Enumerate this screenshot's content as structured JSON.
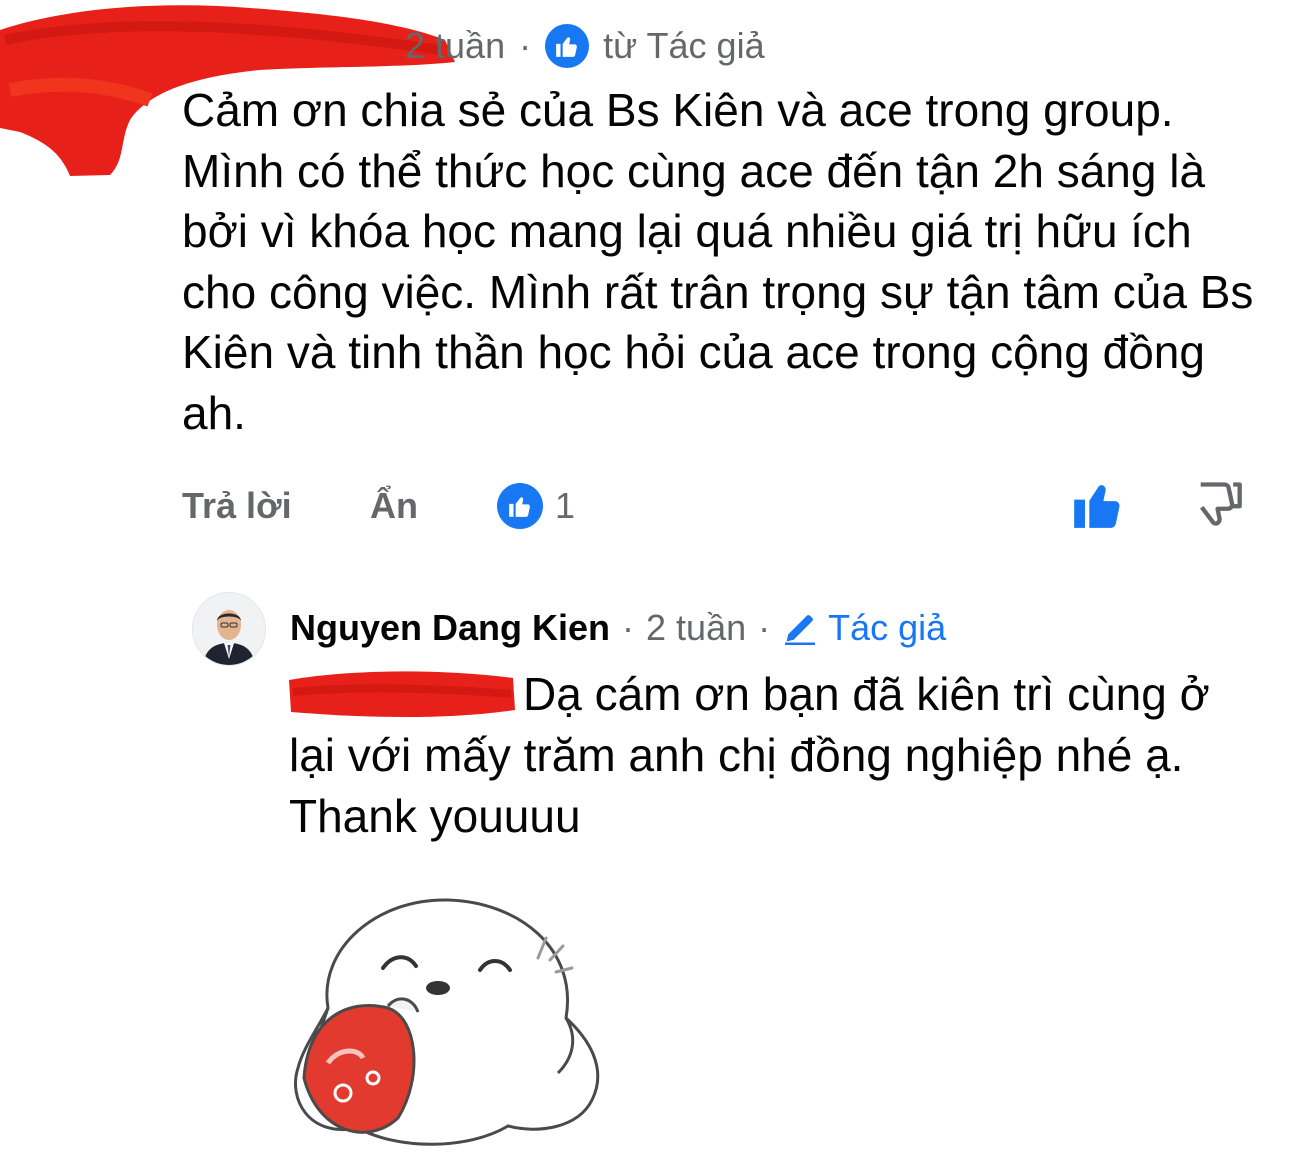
{
  "top_comment": {
    "author_name_partial": "",
    "time": "2 tuần",
    "separator": "·",
    "like_badge_icon": "thumbs-up-icon",
    "by_author_label": "từ Tác giả",
    "text": "Cảm ơn chia sẻ của Bs Kiên và ace trong group. Mình có thể thức  học cùng ace đến tận 2h sáng là bởi vì khóa học mang lại quá nhiều giá trị hữu ích cho công việc. Mình rất trân trọng sự tận tâm của Bs Kiên và tinh thần học hỏi của ace trong cộng đồng ah.",
    "actions": {
      "reply_label": "Trả lời",
      "hide_label": "Ẩn",
      "reaction_count": "1"
    }
  },
  "reply": {
    "author_name": "Nguyen Dang Kien",
    "separator": "·",
    "time": "2 tuần",
    "author_tag": "Tác giả",
    "text": "Dạ cám ơn bạn đã kiên trì cùng ở lại với mấy trăm anh chị đồng nghiệp nhé ạ. Thank youuuu",
    "sticker_icon": "dog-hugging-heart-sticker"
  },
  "colors": {
    "accent_blue": "#1877f2",
    "meta_gray": "#65676b",
    "text_black": "#050505",
    "redaction_red": "#e8201a"
  }
}
